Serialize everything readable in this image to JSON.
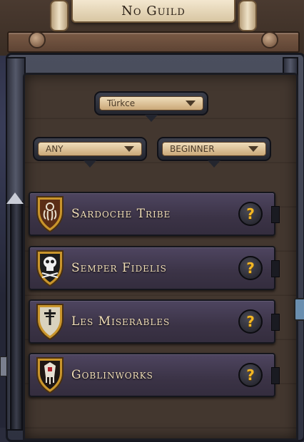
{
  "header": {
    "title": "No Guild"
  },
  "filters": {
    "language": "Türkce",
    "guild_type": "ANY",
    "level": "BEGINNER"
  },
  "guilds": [
    {
      "name": "Sardoche Tribe",
      "emblem": "kraken-icon",
      "help_label": "?"
    },
    {
      "name": "Semper Fidelis",
      "emblem": "skull-icon",
      "help_label": "?"
    },
    {
      "name": "Les Miserables",
      "emblem": "cross-icon",
      "help_label": "?"
    },
    {
      "name": "Goblinworks",
      "emblem": "goblin-icon",
      "help_label": "?"
    }
  ],
  "colors": {
    "guild_text": "#f2dfb8",
    "help_icon": "#f2b726",
    "shield_gold": "#c9952c"
  }
}
